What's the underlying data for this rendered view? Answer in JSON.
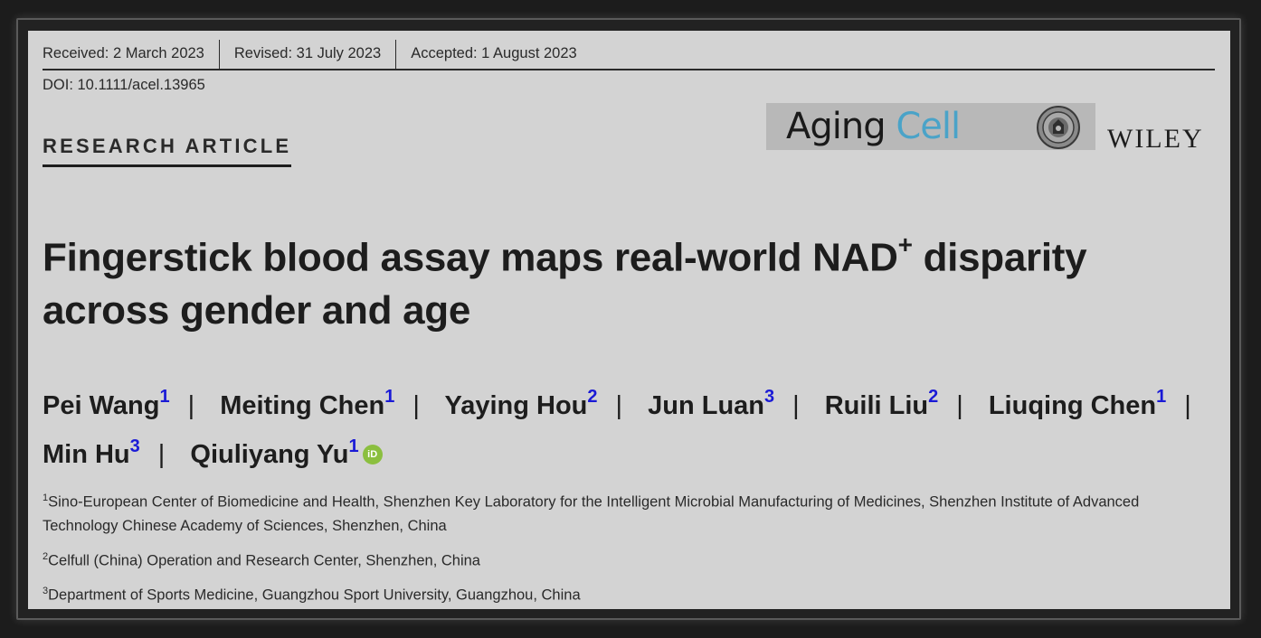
{
  "dates": {
    "received": "Received: 2 March 2023",
    "revised": "Revised: 31 July 2023",
    "accepted": "Accepted: 1 August 2023"
  },
  "doi": "DOI: 10.1111/acel.13965",
  "article_type": "RESEARCH ARTICLE",
  "journal": {
    "name_part1": "Aging",
    "name_part2": "Cell",
    "accent_color": "#4aa3c8"
  },
  "publisher": "WILEY",
  "title": {
    "part1": "Fingerstick blood assay maps real-world NAD",
    "superscript": "+",
    "part2": " disparity across gender and age"
  },
  "authors": [
    {
      "name": "Pei Wang",
      "affil": "1"
    },
    {
      "name": "Meiting Chen",
      "affil": "1"
    },
    {
      "name": "Yaying Hou",
      "affil": "2"
    },
    {
      "name": "Jun Luan",
      "affil": "3"
    },
    {
      "name": "Ruili Liu",
      "affil": "2"
    },
    {
      "name": "Liuqing Chen",
      "affil": "1"
    },
    {
      "name": "Min Hu",
      "affil": "3"
    },
    {
      "name": "Qiuliyang Yu",
      "affil": "1",
      "orcid": "iD"
    }
  ],
  "affiliations": [
    {
      "num": "1",
      "text": "Sino-European Center of Biomedicine and Health, Shenzhen Key Laboratory for the Intelligent Microbial Manufacturing of Medicines, Shenzhen Institute of Advanced Technology Chinese Academy of Sciences, Shenzhen, China"
    },
    {
      "num": "2",
      "text": "Celfull (China) Operation and Research Center, Shenzhen, China"
    },
    {
      "num": "3",
      "text": "Department of Sports Medicine, Guangzhou Sport University, Guangzhou, China"
    }
  ]
}
